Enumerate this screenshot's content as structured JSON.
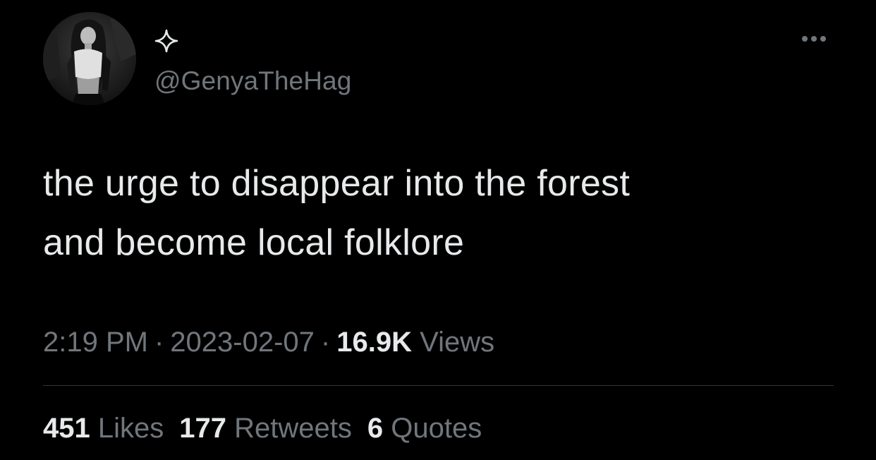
{
  "tweet": {
    "handle": "@GenyaTheHag",
    "display_name_icon": "sparkle-icon",
    "avatar_icon": "profile-photo",
    "more_icon": "more-options-icon",
    "text_lines": [
      "the urge to disappear into the forest",
      "and become local folklore"
    ],
    "time": "2:19 PM",
    "date": "2023-02-07",
    "separator": "·",
    "views_count": "16.9K",
    "views_label": "Views",
    "stats": {
      "likes_count": "451",
      "likes_label": "Likes",
      "retweets_count": "177",
      "retweets_label": "Retweets",
      "quotes_count": "6",
      "quotes_label": "Quotes"
    }
  },
  "colors": {
    "background": "#000000",
    "primary_text": "#e7e9ea",
    "secondary_text": "#71767b",
    "divider": "#2f3336"
  }
}
